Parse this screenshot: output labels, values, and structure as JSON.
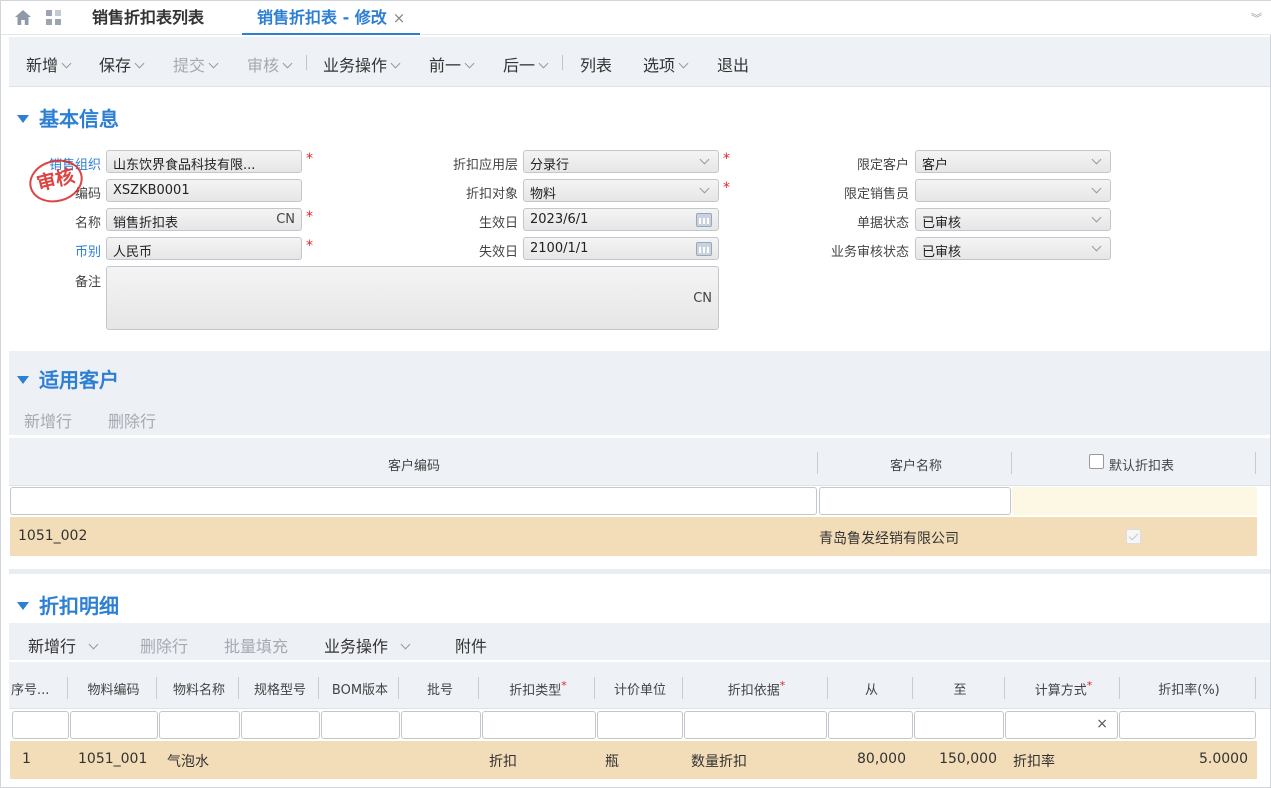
{
  "tabs": [
    {
      "label": "销售折扣表列表"
    },
    {
      "label": "销售折扣表 - 修改",
      "close": "×"
    }
  ],
  "toolbar": {
    "items": [
      {
        "label": "新增"
      },
      {
        "label": "保存"
      },
      {
        "label": "提交"
      },
      {
        "label": "审核"
      },
      {
        "label": "业务操作"
      },
      {
        "label": "前一"
      },
      {
        "label": "后一"
      },
      {
        "label": "列表"
      },
      {
        "label": "选项"
      },
      {
        "label": "退出"
      }
    ]
  },
  "basic": {
    "title": "基本信息",
    "stamp": "审核",
    "fields": {
      "sales_org": {
        "label": "销售组织",
        "value": "山东饮界食品科技有限..."
      },
      "code": {
        "label": "编码",
        "value": "XSZKB0001"
      },
      "name": {
        "label": "名称",
        "value": "销售折扣表",
        "suffix": "CN"
      },
      "currency": {
        "label": "币别",
        "value": "人民币"
      },
      "remark": {
        "label": "备注",
        "value": "",
        "suffix": "CN"
      },
      "apply_level": {
        "label": "折扣应用层",
        "value": "分录行"
      },
      "discount_object": {
        "label": "折扣对象",
        "value": "物料"
      },
      "effective_date": {
        "label": "生效日",
        "value": "2023/6/1"
      },
      "expiry_date": {
        "label": "失效日",
        "value": "2100/1/1"
      },
      "limit_customer": {
        "label": "限定客户",
        "value": "客户"
      },
      "limit_salesman": {
        "label": "限定销售员",
        "value": ""
      },
      "doc_status": {
        "label": "单据状态",
        "value": "已审核"
      },
      "biz_audit_status": {
        "label": "业务审核状态",
        "value": "已审核"
      }
    }
  },
  "customers": {
    "title": "适用客户",
    "buttons": {
      "add_row": "新增行",
      "delete_row": "删除行"
    },
    "columns": {
      "code": "客户编码",
      "name": "客户名称",
      "default": "默认折扣表"
    },
    "rows": [
      {
        "code": "1051_002",
        "name": "青岛鲁发经销有限公司",
        "default": true
      }
    ]
  },
  "details": {
    "title": "折扣明细",
    "buttons": {
      "add_row": "新增行",
      "delete_row": "删除行",
      "batch_fill": "批量填充",
      "biz_ops": "业务操作",
      "attachment": "附件"
    },
    "columns": [
      "序号...",
      "物料编码",
      "物料名称",
      "规格型号",
      "BOM版本",
      "批号",
      "折扣类型",
      "计价单位",
      "折扣依据",
      "从",
      "至",
      "计算方式",
      "折扣率(%)"
    ],
    "filter_clear": "×",
    "rows": [
      {
        "seq": "1",
        "material_code": "1051_001",
        "material_name": "气泡水",
        "spec": "",
        "bom": "",
        "batch": "",
        "discount_type": "折扣",
        "unit": "瓶",
        "basis": "数量折扣",
        "from": "80,000",
        "to": "150,000",
        "calc_method": "折扣率",
        "rate": "5.0000"
      }
    ]
  },
  "colors": {
    "accent": "#2d7fd4",
    "required": "#e0262b",
    "row_highlight": "#f3ddb8",
    "stamp": "#d92b2b"
  }
}
